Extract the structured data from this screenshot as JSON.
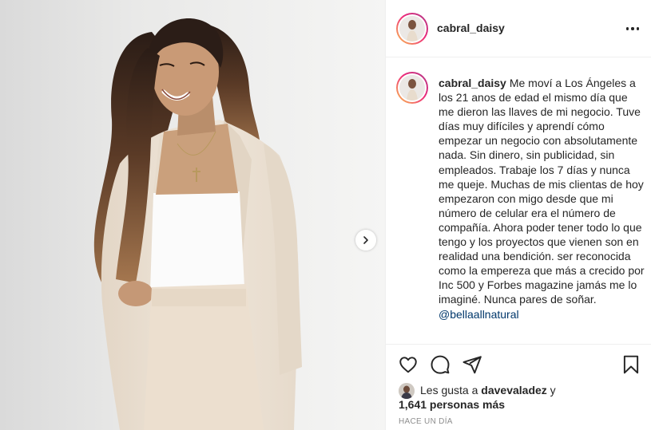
{
  "post": {
    "username": "cabral_daisy",
    "caption_username": "cabral_daisy",
    "caption_text": "Me moví a Los Ángeles a los 21 anos de edad el mismo día que me dieron las llaves de mi negocio. Tuve días muy difíciles y aprendí cómo empezar un negocio con absolutamente nada. Sin dinero, sin publicidad, sin empleados. Trabaje los 7 días y nunca me queje. Muchas de mis clientas de hoy empezaron con migo desde que mi número de celular era el número de compañía. Ahora poder tener todo lo que tengo y los proyectos que vienen son en realidad una bendición. ser reconocida como la empereza que más a crecido por Inc 500 y Forbes magazine jamás me lo imaginé. Nunca pares de soñar.",
    "caption_mention": "@bellaallnatural",
    "likes_prefix": "Les gusta a",
    "liked_by_user": "davevaladez",
    "likes_conjunction": "y",
    "likes_others": "1,641 personas más",
    "timestamp": "HACE UN DÍA"
  },
  "icons": {
    "more": "more-options-icon",
    "like": "heart-icon",
    "comment": "comment-icon",
    "share": "share-icon",
    "save": "bookmark-icon",
    "next": "chevron-right-icon"
  },
  "colors": {
    "text": "#262626",
    "secondary": "#8e8e8e",
    "link": "#00376b",
    "divider": "#efefef",
    "story_ring_start": "#f9c44f",
    "story_ring_end": "#c13584"
  }
}
